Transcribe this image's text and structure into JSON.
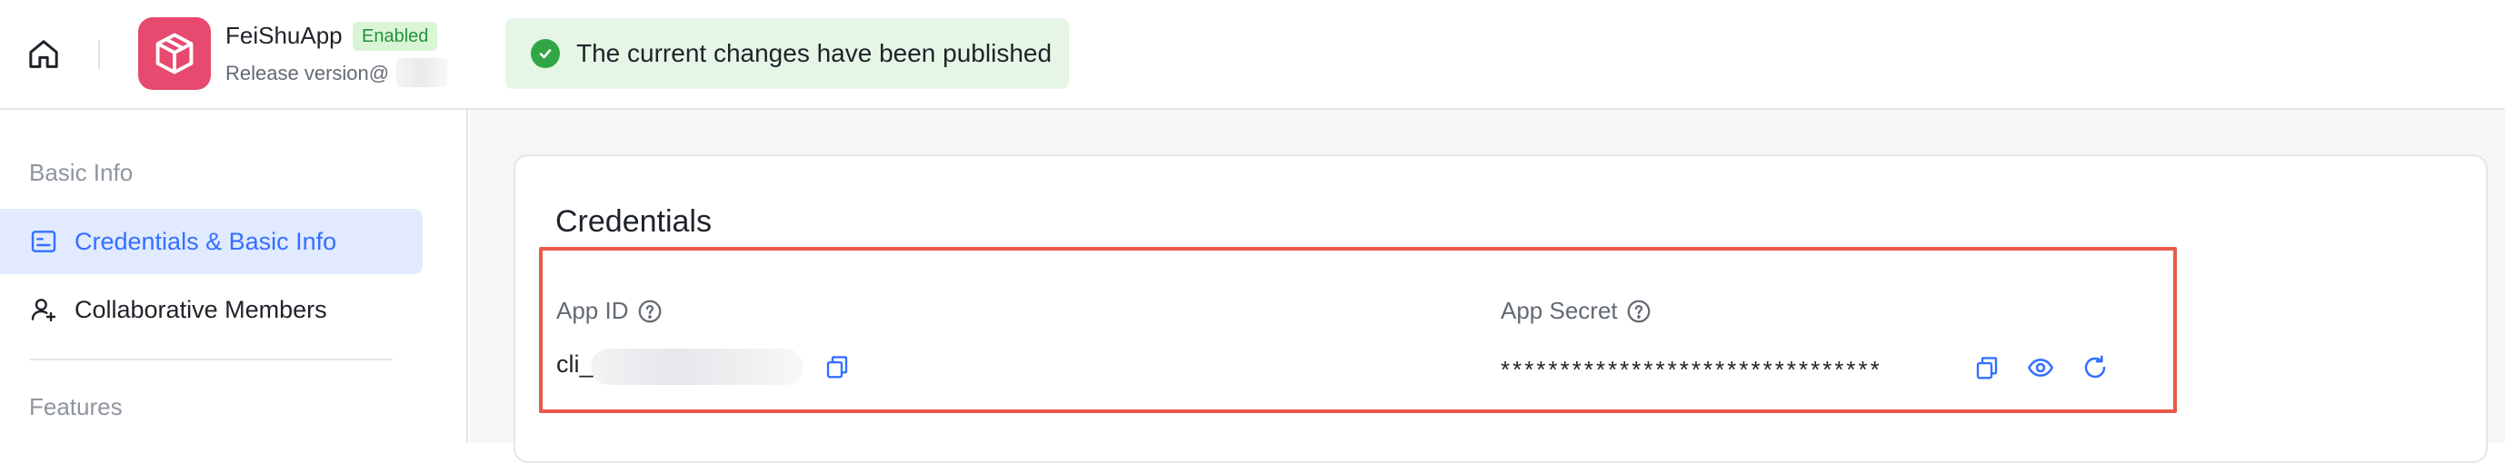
{
  "header": {
    "app_name": "FeiShuApp",
    "status_badge": "Enabled",
    "release_label": "Release version@",
    "toast_message": "The current changes have been published"
  },
  "sidebar": {
    "section_basic": "Basic Info",
    "items": [
      {
        "label": "Credentials & Basic Info",
        "icon": "id-card-icon",
        "active": true
      },
      {
        "label": "Collaborative Members",
        "icon": "add-member-icon",
        "active": false
      }
    ],
    "section_features": "Features"
  },
  "credentials": {
    "title": "Credentials",
    "app_id_label": "App ID",
    "app_id_value": "cli_",
    "app_secret_label": "App Secret",
    "app_secret_value": "********************************"
  },
  "colors": {
    "accent": "#3370ff",
    "success": "#32a645",
    "highlight": "#eb5a49",
    "app_icon": "#e8496e"
  }
}
